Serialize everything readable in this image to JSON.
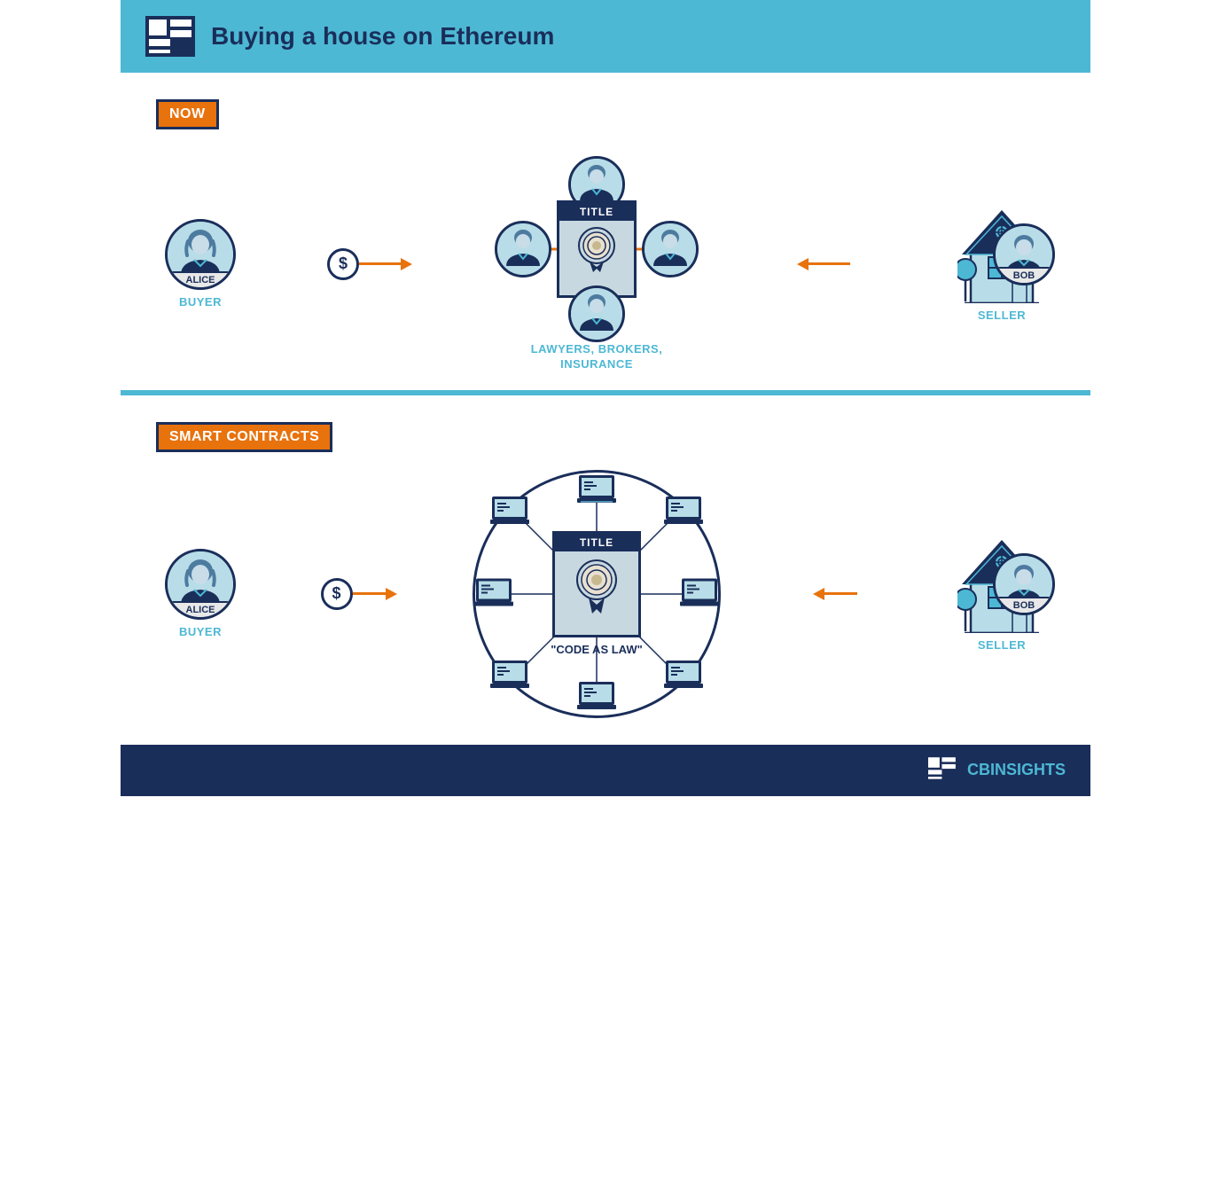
{
  "header": {
    "title": "Buying a house on Ethereum"
  },
  "section1": {
    "badge": "NOW",
    "buyer_name": "ALICE",
    "buyer_label": "BUYER",
    "seller_name": "BOB",
    "seller_label": "SELLER",
    "middle_label_line1": "LAWYERS, BROKERS,",
    "middle_label_line2": "INSURANCE",
    "title_text": "TITLE"
  },
  "section2": {
    "badge": "SMART CONTRACTS",
    "buyer_name": "ALICE",
    "buyer_label": "BUYER",
    "seller_name": "BOB",
    "seller_label": "SELLER",
    "title_text": "TITLE",
    "code_as_law": "\"CODE AS LAW\""
  },
  "footer": {
    "logo_prefix": "",
    "logo_cb": "CB",
    "logo_insights": "INSIGHTS"
  },
  "colors": {
    "dark_blue": "#1a2e5a",
    "light_blue": "#4db8d4",
    "orange": "#e8720c",
    "light_bg": "#b8dde8",
    "doc_bg": "#c8d8e0"
  }
}
